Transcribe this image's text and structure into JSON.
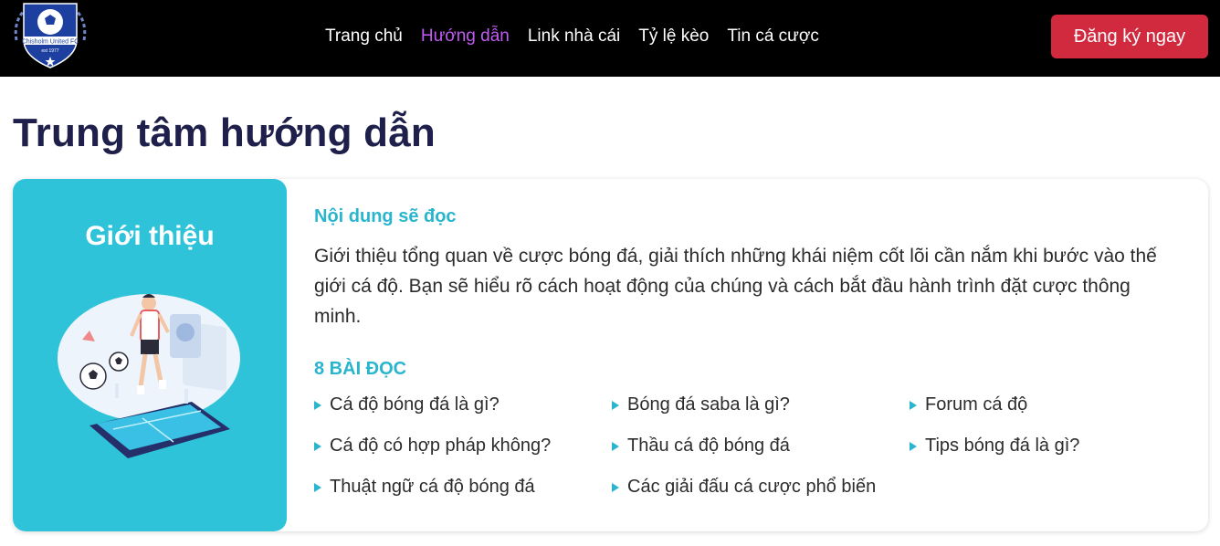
{
  "header": {
    "logo_text": "Chisholm United FC",
    "nav": [
      {
        "label": "Trang chủ",
        "active": false
      },
      {
        "label": "Hướng dẫn",
        "active": true
      },
      {
        "label": "Link nhà cái",
        "active": false
      },
      {
        "label": "Tỷ lệ kèo",
        "active": false
      },
      {
        "label": "Tin cá cược",
        "active": false
      }
    ],
    "cta_label": "Đăng ký ngay"
  },
  "page": {
    "title": "Trung tâm hướng dẫn"
  },
  "card": {
    "left_title": "Giới thiệu",
    "subhead": "Nội dung sẽ đọc",
    "description": "Giới thiệu tổng quan về cược bóng đá, giải thích những khái niệm cốt lõi cần nắm khi bước vào thế giới cá độ. Bạn sẽ hiểu rõ cách hoạt động của chúng và cách bắt đầu hành trình đặt cược thông minh.",
    "count_label": "8 BÀI ĐỌC",
    "articles": [
      "Cá độ bóng đá là gì?",
      "Bóng đá saba là gì?",
      "Forum cá độ",
      "Cá độ có hợp pháp không?",
      "Thầu cá độ bóng đá",
      "Tips bóng đá là gì?",
      "Thuật ngữ cá độ bóng đá",
      "Các giải đấu cá cược phổ biến"
    ]
  },
  "colors": {
    "header_bg": "#000000",
    "nav_active": "#c15bf2",
    "cta_bg": "#d12a3f",
    "accent_teal": "#2ec3d9",
    "title_navy": "#1e1f4b"
  },
  "icons": [
    "club-logo-icon",
    "football-illustration",
    "triangle-bullet-icon"
  ]
}
